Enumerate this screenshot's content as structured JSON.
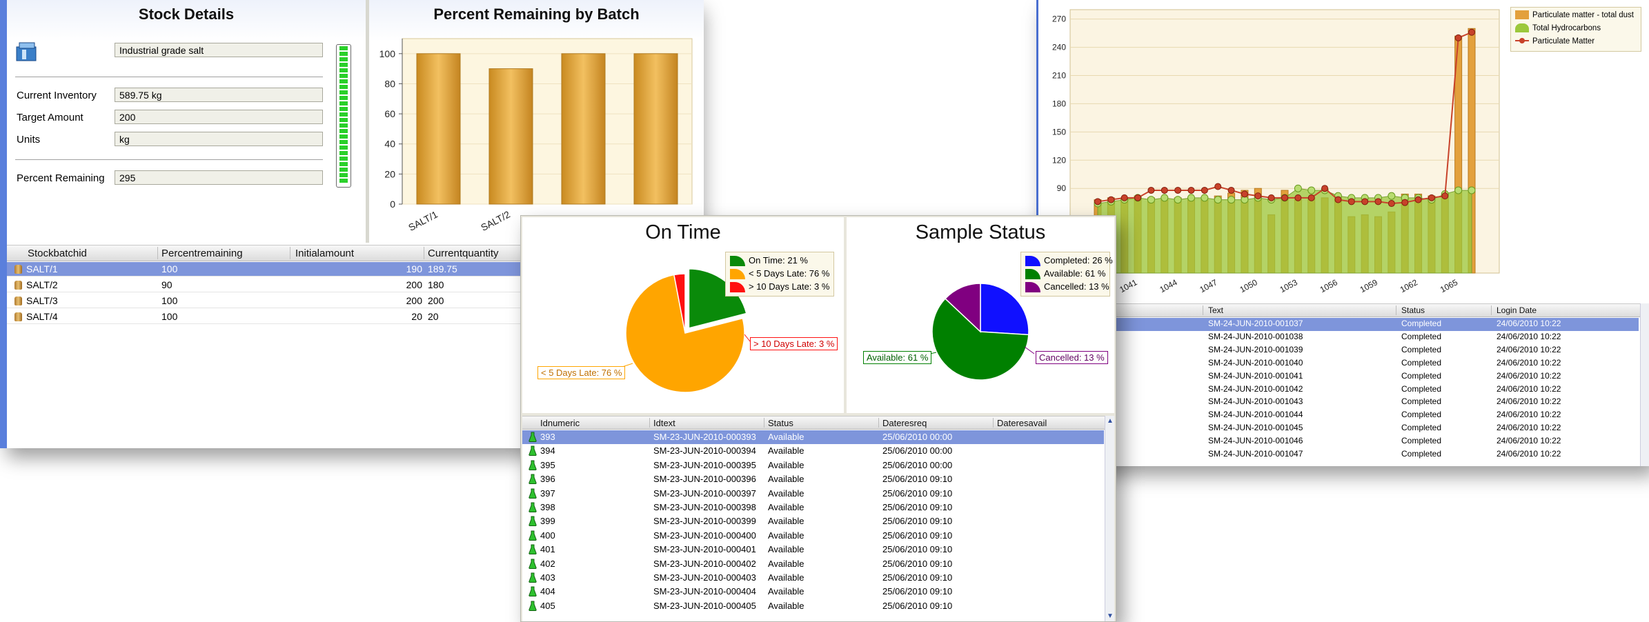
{
  "stock": {
    "title": "Stock Details",
    "material": "Industrial grade salt",
    "fields": [
      {
        "label": "Current Inventory",
        "value": "589.75 kg"
      },
      {
        "label": "Target Amount",
        "value": "200"
      },
      {
        "label": "Units",
        "value": "kg"
      }
    ],
    "percent_label": "Percent Remaining",
    "percent_value": "295",
    "level_fraction": 1.0,
    "grid": {
      "columns": [
        "Stockbatchid",
        "Percentremaining",
        "Initialamount",
        "Currentquantity"
      ],
      "rows": [
        {
          "id": "SALT/1",
          "pct": "100",
          "init": "190",
          "cur": "189.75",
          "selected": true
        },
        {
          "id": "SALT/2",
          "pct": "90",
          "init": "200",
          "cur": "180",
          "selected": false
        },
        {
          "id": "SALT/3",
          "pct": "100",
          "init": "200",
          "cur": "200",
          "selected": false
        },
        {
          "id": "SALT/4",
          "pct": "100",
          "init": "20",
          "cur": "20",
          "selected": false
        }
      ]
    }
  },
  "batch_chart": {
    "title": "Percent Remaining by Batch",
    "type": "bar",
    "categories": [
      "SALT/1",
      "SALT/2",
      "SALT/3",
      "SALT/4"
    ],
    "values": [
      100,
      90,
      100,
      100
    ],
    "ylim": [
      0,
      110
    ],
    "yticks": [
      0,
      20,
      40,
      60,
      80,
      100
    ],
    "xtick_labels": [
      "SALT/1",
      "SALT/2"
    ],
    "bar_color": "#e0a83a"
  },
  "on_time": {
    "title": "On Time",
    "type": "pie",
    "slices": [
      {
        "label": "On Time: 21 %",
        "value": 21,
        "color": "#0a8a0a"
      },
      {
        "label": "< 5 Days Late: 76 %",
        "value": 76,
        "color": "#ffa500"
      },
      {
        "label": "> 10 Days Late: 3 %",
        "value": 3,
        "color": "#ff1010"
      }
    ],
    "callouts": {
      "late5": "< 5 Days Late: 76 %",
      "late10": "> 10 Days Late: 3 %"
    }
  },
  "sample_status": {
    "title": "Sample Status",
    "type": "pie",
    "slices": [
      {
        "label": "Completed: 26 %",
        "value": 26,
        "color": "#1010ff"
      },
      {
        "label": "Available: 61 %",
        "value": 61,
        "color": "#008000"
      },
      {
        "label": "Cancelled: 13 %",
        "value": 13,
        "color": "#800080"
      }
    ],
    "callouts": {
      "available": "Available: 61 %",
      "cancelled": "Cancelled: 13 %"
    }
  },
  "samples_grid": {
    "columns": [
      "Idnumeric",
      "Idtext",
      "Status",
      "Dateresreq",
      "Dateresavail"
    ],
    "rows": [
      [
        "393",
        "SM-23-JUN-2010-000393",
        "Available",
        "25/06/2010 00:00"
      ],
      [
        "394",
        "SM-23-JUN-2010-000394",
        "Available",
        "25/06/2010 00:00"
      ],
      [
        "395",
        "SM-23-JUN-2010-000395",
        "Available",
        "25/06/2010 00:00"
      ],
      [
        "396",
        "SM-23-JUN-2010-000396",
        "Available",
        "25/06/2010 09:10"
      ],
      [
        "397",
        "SM-23-JUN-2010-000397",
        "Available",
        "25/06/2010 09:10"
      ],
      [
        "398",
        "SM-23-JUN-2010-000398",
        "Available",
        "25/06/2010 09:10"
      ],
      [
        "399",
        "SM-23-JUN-2010-000399",
        "Available",
        "25/06/2010 09:10"
      ],
      [
        "400",
        "SM-23-JUN-2010-000400",
        "Available",
        "25/06/2010 09:10"
      ],
      [
        "401",
        "SM-23-JUN-2010-000401",
        "Available",
        "25/06/2010 09:10"
      ],
      [
        "402",
        "SM-23-JUN-2010-000402",
        "Available",
        "25/06/2010 09:10"
      ],
      [
        "403",
        "SM-23-JUN-2010-000403",
        "Available",
        "25/06/2010 09:10"
      ],
      [
        "404",
        "SM-23-JUN-2010-000404",
        "Available",
        "25/06/2010 09:10"
      ],
      [
        "405",
        "SM-23-JUN-2010-000405",
        "Available",
        "25/06/2010 09:10"
      ]
    ]
  },
  "trend_chart": {
    "type": "bar+line",
    "yticks": [
      90,
      120,
      150,
      180,
      210,
      240,
      270
    ],
    "ylim": [
      0,
      280
    ],
    "xtick_labels": [
      "1041",
      "1044",
      "1047",
      "1050",
      "1053",
      "1056",
      "1059",
      "1062",
      "1065"
    ],
    "legend": [
      "Particulate matter - total dust",
      "Total Hydrocarbons",
      "Particulate Matter"
    ],
    "x": [
      1038,
      1039,
      1040,
      1041,
      1042,
      1043,
      1044,
      1045,
      1046,
      1047,
      1048,
      1049,
      1050,
      1051,
      1052,
      1053,
      1054,
      1055,
      1056,
      1057,
      1058,
      1059,
      1060,
      1061,
      1062,
      1063,
      1064,
      1065,
      1066
    ],
    "bar_values": [
      78,
      80,
      80,
      82,
      80,
      78,
      80,
      80,
      78,
      82,
      85,
      88,
      90,
      62,
      88,
      78,
      80,
      80,
      82,
      60,
      62,
      60,
      65,
      84,
      84,
      82,
      84,
      252,
      260
    ],
    "area_values": [
      74,
      76,
      78,
      80,
      78,
      80,
      78,
      80,
      80,
      78,
      78,
      78,
      80,
      78,
      80,
      90,
      88,
      88,
      82,
      80,
      80,
      80,
      82,
      80,
      80,
      78,
      84,
      88,
      88
    ],
    "line_values": [
      76,
      78,
      80,
      80,
      88,
      88,
      88,
      88,
      88,
      92,
      88,
      84,
      82,
      80,
      80,
      80,
      80,
      90,
      78,
      76,
      76,
      76,
      74,
      75,
      78,
      80,
      82,
      250,
      256
    ],
    "bar_color": "#e3a03c",
    "area_color": "#9cc83c",
    "line_color": "#c8422a"
  },
  "logins_grid": {
    "columns": [
      "Text",
      "Status",
      "Login Date"
    ],
    "rows": [
      [
        "SM-24-JUN-2010-001037",
        "Completed",
        "24/06/2010 10:22"
      ],
      [
        "SM-24-JUN-2010-001038",
        "Completed",
        "24/06/2010 10:22"
      ],
      [
        "SM-24-JUN-2010-001039",
        "Completed",
        "24/06/2010 10:22"
      ],
      [
        "SM-24-JUN-2010-001040",
        "Completed",
        "24/06/2010 10:22"
      ],
      [
        "SM-24-JUN-2010-001041",
        "Completed",
        "24/06/2010 10:22"
      ],
      [
        "SM-24-JUN-2010-001042",
        "Completed",
        "24/06/2010 10:22"
      ],
      [
        "SM-24-JUN-2010-001043",
        "Completed",
        "24/06/2010 10:22"
      ],
      [
        "SM-24-JUN-2010-001044",
        "Completed",
        "24/06/2010 10:22"
      ],
      [
        "SM-24-JUN-2010-001045",
        "Completed",
        "24/06/2010 10:22"
      ],
      [
        "SM-24-JUN-2010-001046",
        "Completed",
        "24/06/2010 10:22"
      ],
      [
        "SM-24-JUN-2010-001047",
        "Completed",
        "24/06/2010 10:22"
      ]
    ]
  }
}
